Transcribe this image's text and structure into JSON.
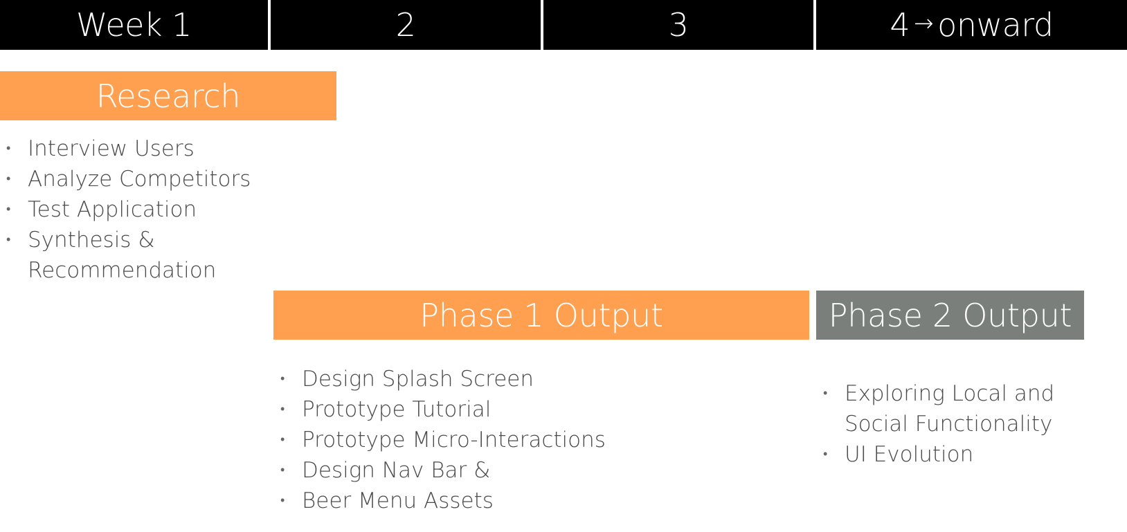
{
  "colors": {
    "header_bg": "#000000",
    "orange": "#FFA051",
    "gray": "#7A7F7C",
    "text": "#4a4a4a"
  },
  "weeks": {
    "w1": "Week 1",
    "w2": "2",
    "w3": "3",
    "w4_num": "4",
    "w4_arrow": "→",
    "w4_word": "onward"
  },
  "research": {
    "title": "Research",
    "tasks": [
      "Interview Users",
      "Analyze Competitors",
      "Test Application",
      "Synthesis &",
      "Recommendation"
    ]
  },
  "phase1": {
    "title": "Phase 1 Output",
    "tasks": [
      "Design Splash Screen",
      "Prototype Tutorial",
      "Prototype Micro-Interactions",
      "Design Nav Bar &",
      "Beer Menu Assets"
    ]
  },
  "phase2": {
    "title": "Phase 2 Output",
    "tasks": [
      "Exploring Local and",
      "Social Functionality",
      "UI Evolution"
    ]
  }
}
